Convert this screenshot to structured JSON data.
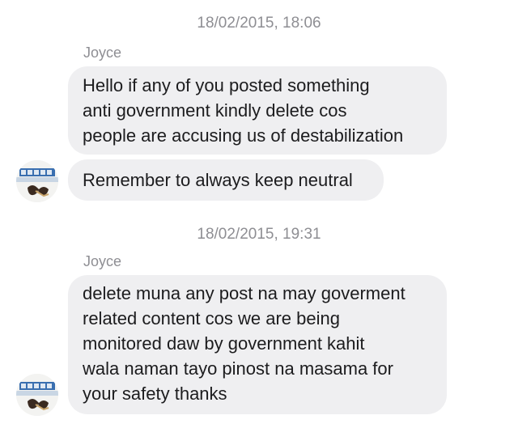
{
  "conversation": {
    "groups": [
      {
        "timestamp": "18/02/2015, 18:06",
        "sender": "Joyce",
        "messages": [
          "Hello if any of you posted something\nanti government kindly delete cos\npeople are accusing us of destabilization",
          "Remember to always keep neutral"
        ],
        "avatar_icon": "profile-photo-sunglasses"
      },
      {
        "timestamp": "18/02/2015, 19:31",
        "sender": "Joyce",
        "messages": [
          "delete muna any post na may goverment\nrelated content cos we are being\nmonitored daw by government kahit\nwala naman tayo pinost na masama for\nyour safety thanks"
        ],
        "avatar_icon": "profile-photo-sunglasses"
      }
    ]
  },
  "colors": {
    "bubble_background": "#efeff1",
    "meta_text": "#8e8e93",
    "message_text": "#1c1c1e"
  }
}
